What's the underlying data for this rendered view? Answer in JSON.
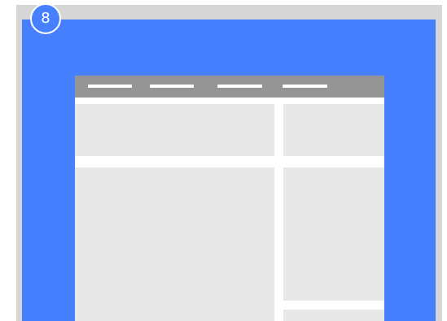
{
  "badge": {
    "number": "8"
  },
  "colors": {
    "accent_blue": "#4680ff",
    "frame_gray": "#d6d6d6",
    "nav_gray": "#959595",
    "block_gray": "#e8e8e8",
    "white": "#ffffff"
  },
  "wireframe": {
    "nav_items": [
      {
        "id": "nav-item-1"
      },
      {
        "id": "nav-item-2"
      },
      {
        "id": "nav-item-3"
      },
      {
        "id": "nav-item-4"
      }
    ],
    "content_blocks": [
      {
        "id": "top-left"
      },
      {
        "id": "top-right"
      },
      {
        "id": "main"
      },
      {
        "id": "side"
      },
      {
        "id": "bottom-right"
      }
    ]
  }
}
